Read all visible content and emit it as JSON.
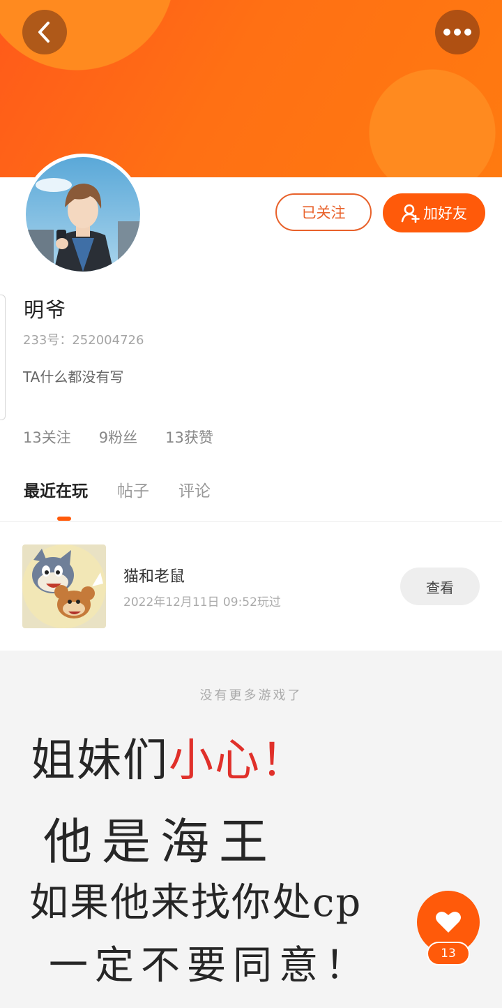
{
  "header": {
    "back_icon": "chevron-left-icon",
    "more_icon": "more-dots-icon"
  },
  "profile": {
    "follow_label": "已关注",
    "add_friend_label": "加好友",
    "add_friend_icon": "add-user-icon",
    "name": "明爷",
    "uid": "233号：252004726",
    "bio": "TA什么都没有写",
    "stats": {
      "following": "13关注",
      "fans": "9粉丝",
      "likes": "13获赞"
    }
  },
  "tabs": [
    {
      "label": "最近在玩",
      "active": true
    },
    {
      "label": "帖子",
      "active": false
    },
    {
      "label": "评论",
      "active": false
    }
  ],
  "recent_game": {
    "name": "猫和老鼠",
    "time": "2022年12月11日 09:52玩过",
    "view_label": "查看"
  },
  "no_more": "没有更多游戏了",
  "note": {
    "line1_black": "姐妹们",
    "line1_red": "小心！",
    "line2": "他是海王",
    "line3": "如果他来找你处cp",
    "line4": "一定不要同意！"
  },
  "like": {
    "icon": "heart-icon",
    "count": "13"
  },
  "colors": {
    "accent": "#ff5a0a",
    "header": "#ff6a14",
    "note_red": "#e0302a"
  }
}
